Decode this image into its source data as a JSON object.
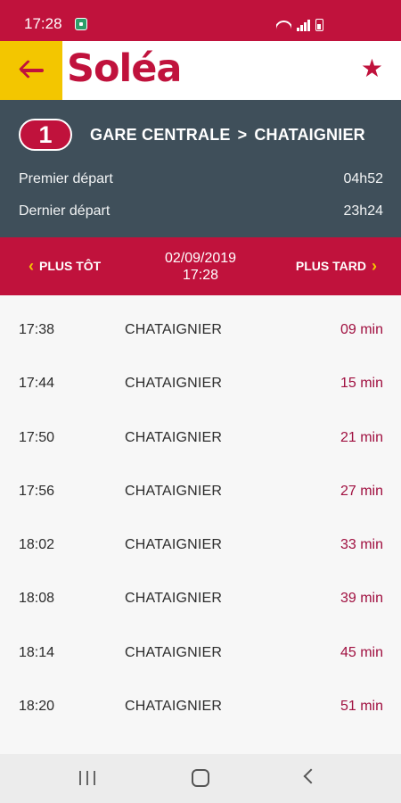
{
  "status_bar": {
    "time": "17:28"
  },
  "app_bar": {
    "logo_text": "Soléa"
  },
  "line": {
    "number": "1",
    "from": "GARE CENTRALE",
    "separator": ">",
    "to": "CHATAIGNIER",
    "first_departure_label": "Premier départ",
    "first_departure_value": "04h52",
    "last_departure_label": "Dernier départ",
    "last_departure_value": "23h24"
  },
  "navigation": {
    "earlier_label": "PLUS TÔT",
    "later_label": "PLUS TARD",
    "date": "02/09/2019",
    "time": "17:28"
  },
  "departures": [
    {
      "time": "17:38",
      "destination": "CHATAIGNIER",
      "wait": "09 min"
    },
    {
      "time": "17:44",
      "destination": "CHATAIGNIER",
      "wait": "15 min"
    },
    {
      "time": "17:50",
      "destination": "CHATAIGNIER",
      "wait": "21 min"
    },
    {
      "time": "17:56",
      "destination": "CHATAIGNIER",
      "wait": "27 min"
    },
    {
      "time": "18:02",
      "destination": "CHATAIGNIER",
      "wait": "33 min"
    },
    {
      "time": "18:08",
      "destination": "CHATAIGNIER",
      "wait": "39 min"
    },
    {
      "time": "18:14",
      "destination": "CHATAIGNIER",
      "wait": "45 min"
    },
    {
      "time": "18:20",
      "destination": "CHATAIGNIER",
      "wait": "51 min"
    }
  ],
  "colors": {
    "brand_red": "#c0123c",
    "accent_yellow": "#f3c600",
    "header_slate": "#3f4f5a",
    "wait_text": "#a01040"
  },
  "icons": {
    "back": "arrow-left-icon",
    "favorite": "star-icon",
    "prev": "chevron-left-icon",
    "next": "chevron-right-icon"
  }
}
